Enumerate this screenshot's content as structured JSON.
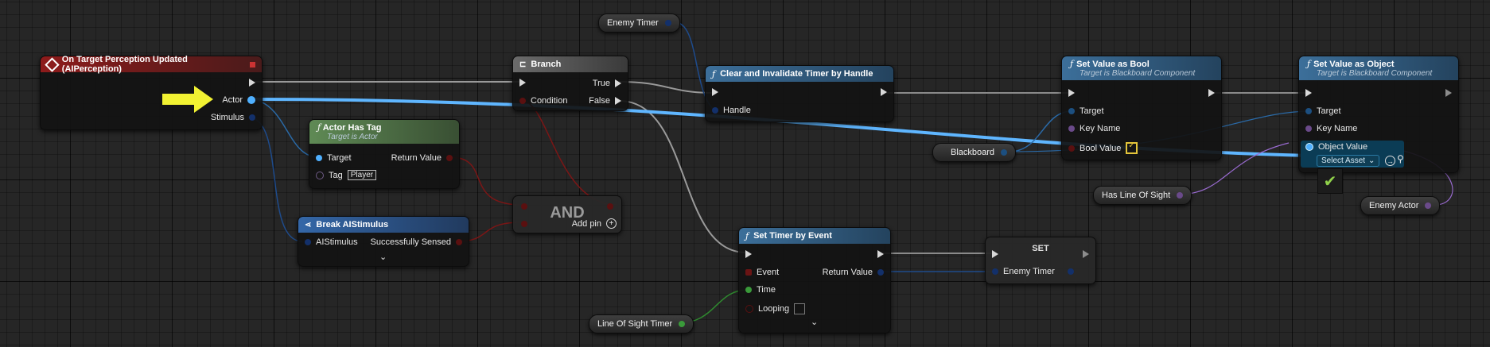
{
  "event_node": {
    "title": "On Target Perception Updated (AIPerception)",
    "pins": {
      "actor": "Actor",
      "stimulus": "Stimulus"
    }
  },
  "branch_node": {
    "title": "Branch",
    "pins": {
      "condition": "Condition",
      "true": "True",
      "false": "False"
    }
  },
  "actor_has_tag_node": {
    "title": "Actor Has Tag",
    "subtitle": "Target is Actor",
    "pins": {
      "target": "Target",
      "tag": "Tag",
      "tag_value": "Player",
      "return_value": "Return Value"
    }
  },
  "break_stimulus_node": {
    "title": "Break AIStimulus",
    "pins": {
      "ai_stimulus": "AIStimulus",
      "successfully_sensed": "Successfully Sensed"
    }
  },
  "and_node": {
    "title": "AND",
    "add_pin": "Add pin"
  },
  "clear_timer_node": {
    "title": "Clear and Invalidate Timer by Handle",
    "pins": {
      "handle": "Handle"
    }
  },
  "set_timer_node": {
    "title": "Set Timer by Event",
    "pins": {
      "event": "Event",
      "time": "Time",
      "looping": "Looping",
      "return_value": "Return Value"
    }
  },
  "set_bool_node": {
    "title": "Set Value as Bool",
    "subtitle": "Target is Blackboard Component",
    "pins": {
      "target": "Target",
      "key_name": "Key Name",
      "bool_value": "Bool Value"
    }
  },
  "set_object_node": {
    "title": "Set Value as Object",
    "subtitle": "Target is Blackboard Component",
    "pins": {
      "target": "Target",
      "key_name": "Key Name",
      "object_value": "Object Value",
      "select_asset": "Select Asset"
    }
  },
  "set_node": {
    "title": "SET",
    "pins": {
      "enemy_timer": "Enemy Timer"
    }
  },
  "variables": {
    "enemy_timer_top": "Enemy Timer",
    "blackboard": "Blackboard",
    "has_line_of_sight": "Has Line Of Sight",
    "enemy_actor": "Enemy Actor",
    "line_of_sight_timer": "Line Of Sight Timer"
  },
  "colors": {
    "exec_wire": "#c8c8c8",
    "object_wire": "#5fb6ff",
    "bool_wire": "#8a1515",
    "struct_wire": "#1e4b8c",
    "float_wire": "#2f8a2f",
    "name_wire": "#9a6bd1",
    "pointer": "#f2f232"
  }
}
